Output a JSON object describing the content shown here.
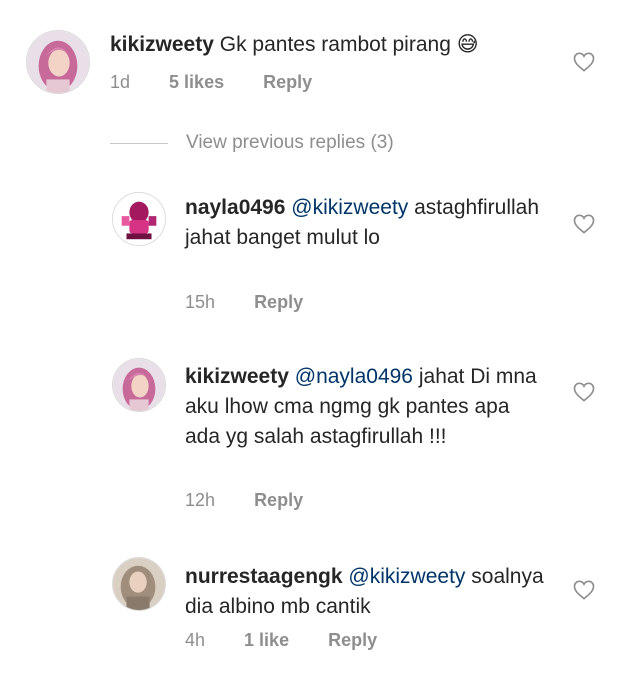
{
  "comments": [
    {
      "username": "kikizweety",
      "mention": "",
      "text": "Gk pantes rambot pirang 😅",
      "time": "1d",
      "likes": "5 likes",
      "reply": "Reply",
      "avatar": "pink-haired-woman"
    },
    {
      "username": "nayla0496",
      "mention": "@kikizweety",
      "text": "astaghfirullah jahat banget mulut lo",
      "time": "15h",
      "likes": "",
      "reply": "Reply",
      "avatar": "pink-fashion-logo"
    },
    {
      "username": "kikizweety",
      "mention": "@nayla0496",
      "text": "jahat Di mna aku lhow cma ngmg gk pantes apa ada yg salah astagfirullah !!!",
      "time": "12h",
      "likes": "",
      "reply": "Reply",
      "avatar": "pink-haired-woman"
    },
    {
      "username": "nurrestaagengk",
      "mention": "@kikizweety",
      "text": "soalnya dia albino mb cantik",
      "time": "4h",
      "likes": "1 like",
      "reply": "Reply",
      "avatar": "hijab-woman"
    }
  ],
  "view_previous": "View previous replies (3)",
  "icons": {
    "like": "heart-outline-icon"
  },
  "colors": {
    "text": "#262626",
    "meta": "#8e8e8e",
    "mention": "#003569"
  }
}
